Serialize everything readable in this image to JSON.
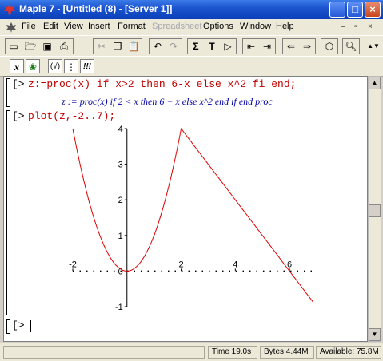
{
  "window": {
    "title": "Maple 7 - [Untitled (8) - [Server 1]]"
  },
  "menu": [
    {
      "label": "File"
    },
    {
      "label": "Edit"
    },
    {
      "label": "View"
    },
    {
      "label": "Insert"
    },
    {
      "label": "Format"
    },
    {
      "label": "Spreadsheet",
      "disabled": true
    },
    {
      "label": "Options"
    },
    {
      "label": "Window"
    },
    {
      "label": "Help"
    }
  ],
  "toolbar2": {
    "math_label": "x",
    "eval_label": "(√)",
    "sep_label": "⋮",
    "exec_label": "!!!"
  },
  "worksheet": {
    "prompt": "[>",
    "input1": "z:=proc(x) if x>2 then 6-x else x^2 fi end;",
    "output1": "z := proc(x) if 2 < x then 6 − x else x^2 end if end proc",
    "input2": "plot(z,-2..7);",
    "prompt3": "[>"
  },
  "chart_data": {
    "type": "line",
    "series": [
      {
        "x": [
          -2,
          -1.5,
          -1,
          -0.5,
          0,
          0.5,
          1,
          1.5,
          2,
          2.5,
          3,
          4,
          5,
          6,
          7
        ],
        "y": [
          4,
          2.25,
          1,
          0.25,
          0,
          0.25,
          1,
          2.25,
          4,
          3.5,
          3,
          2,
          1,
          0,
          -1
        ]
      }
    ],
    "xlim": [
      -2,
      7
    ],
    "ylim": [
      -1,
      4
    ],
    "x_ticks": [
      "-2",
      "2",
      "4",
      "6"
    ],
    "y_ticks": [
      "-1",
      "1",
      "2",
      "3",
      "4"
    ],
    "color": "#e00000",
    "grid": false
  },
  "status": {
    "time": "Time  19.0s",
    "bytes": "Bytes  4.44M",
    "available": "Available: 75.8M"
  }
}
